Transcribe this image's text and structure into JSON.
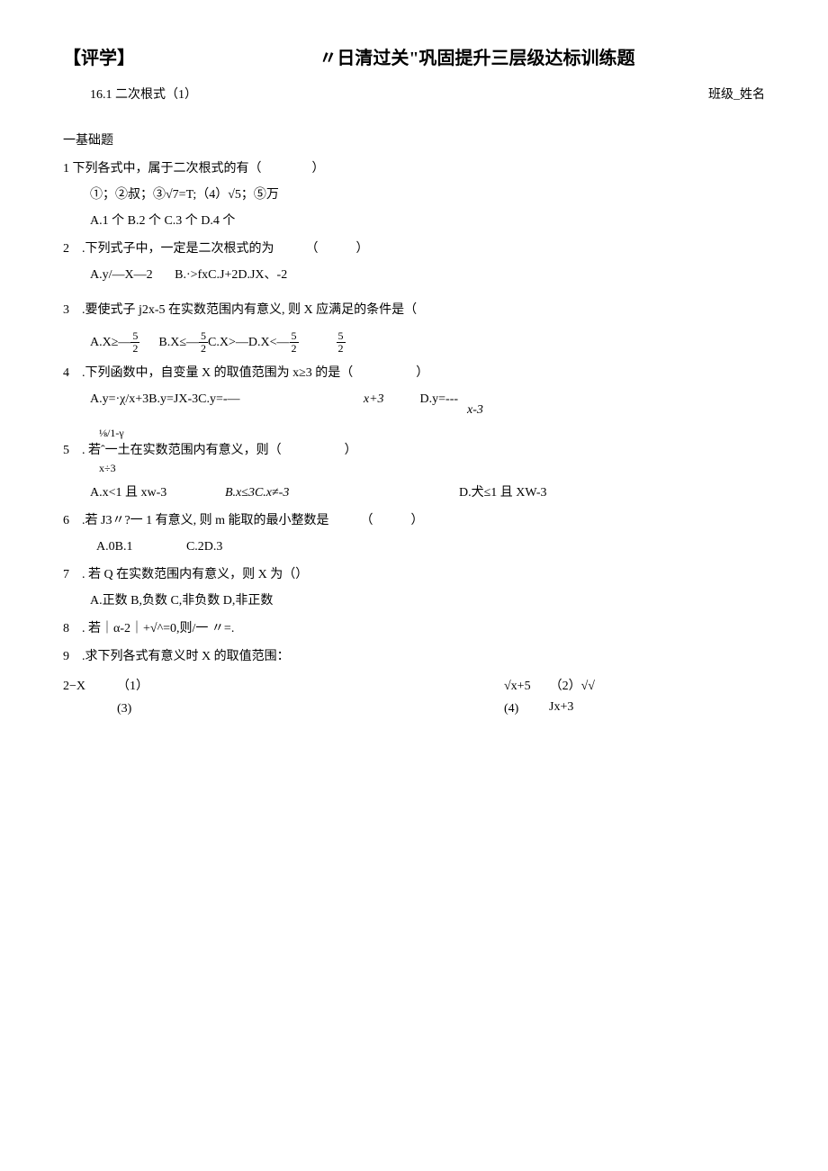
{
  "header": {
    "left": "【评学】",
    "center": "〃日清过关\"巩固提升三层级达标训练题"
  },
  "subheader": {
    "left": "16.1 二次根式（1）",
    "right_class": "班级_",
    "right_name": "姓名"
  },
  "section": "一基础题",
  "q1": {
    "stem": "1 下列各式中，属于二次根式的有（　　　　）",
    "items": "①；②叔；③√7=T;（4）√5；⑤万",
    "opts": "A.1 个 B.2 个 C.3 个 D.4 个"
  },
  "q2": {
    "stem": "2　.下列式子中，一定是二次根式的为　　　（　　　）",
    "opts_a": "A.y/—X—2",
    "opts_b": "B.·>fxC.J+2D.JX、-2"
  },
  "q3": {
    "stem": "3　.要使式子 j2x-5 在实数范围内有意义, 则 X 应满足的条件是（",
    "a_pre": "A.X≥—",
    "frac_n": "5",
    "frac_d": "2",
    "b_pre": "B.X≤—",
    "c_pre": "C.X>—D.X<—"
  },
  "q4": {
    "stem": "4　.下列函数中，自变量 X 的取值范围为 x≥3 的是（　　　　　）",
    "line": "A.y=·χ/x+3B.y=JX-3C.y=-—",
    "x3a": "x+3",
    "d": "D.y=---",
    "x3b": "x-3"
  },
  "q5": {
    "top": "⅛/1-γ",
    "stem": "5　. 若ˆ一土在实数范围内有意义，则（　　　　　）",
    "bot": "x÷3",
    "a": "A.x<1 且 xw-3",
    "b": "B.x≤3C.x≠-3",
    "d": "D.犬≤1 且 XW-3"
  },
  "q6": {
    "stem": "6　.若 J3〃?一 1 有意义, 则 m 能取的最小整数是　　　（　　　）",
    "a": "A.0B.1",
    "c": "C.2D.3"
  },
  "q7": {
    "stem": "7　. 若 Q 在实数范围内有意义，则 X 为（）",
    "opts": "A.正数 B,负数 C,非负数 D,非正数"
  },
  "q8": {
    "stem": "8　. 若｜α-2｜+√^=0,则/一 〃=."
  },
  "q9": {
    "stem": "9　.求下列各式有意义时 X 的取值范围：",
    "left1": "2−X",
    "p1": "（1）",
    "r1a": "√x+5",
    "r1b": "（2）√√",
    "p3": "(3)",
    "p4": "(4)",
    "jx3": "Jx+3"
  }
}
